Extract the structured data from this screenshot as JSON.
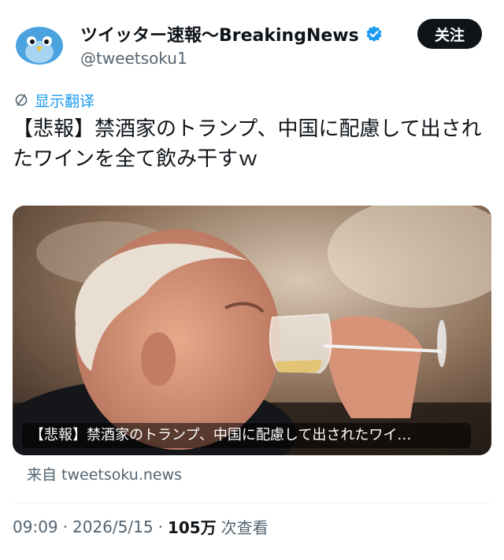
{
  "account": {
    "display_name": "ツイッター速報〜BreakingNews",
    "handle": "@tweetsoku1",
    "follow_label": "关注"
  },
  "post": {
    "translate_label": "显示翻译",
    "text": "【悲報】禁酒家のトランプ、中国に配慮して出されたワインを全て飲み干すｗ",
    "media_caption": "【悲報】禁酒家のトランプ、中国に配慮して出されたワイ…",
    "source": "来自 tweetsoku.news"
  },
  "meta": {
    "time": "09:09",
    "separator_1": "·",
    "date": "2026/5/15",
    "separator_2": "·",
    "views_count": "105万",
    "views_label": "次查看"
  },
  "colors": {
    "accent": "#1d9bf0",
    "text": "#0f1419",
    "secondary_text": "#536471",
    "follow_button": "#0f1419"
  },
  "icons": [
    "bird-avatar-icon",
    "verified-badge-icon",
    "translate-icon"
  ]
}
